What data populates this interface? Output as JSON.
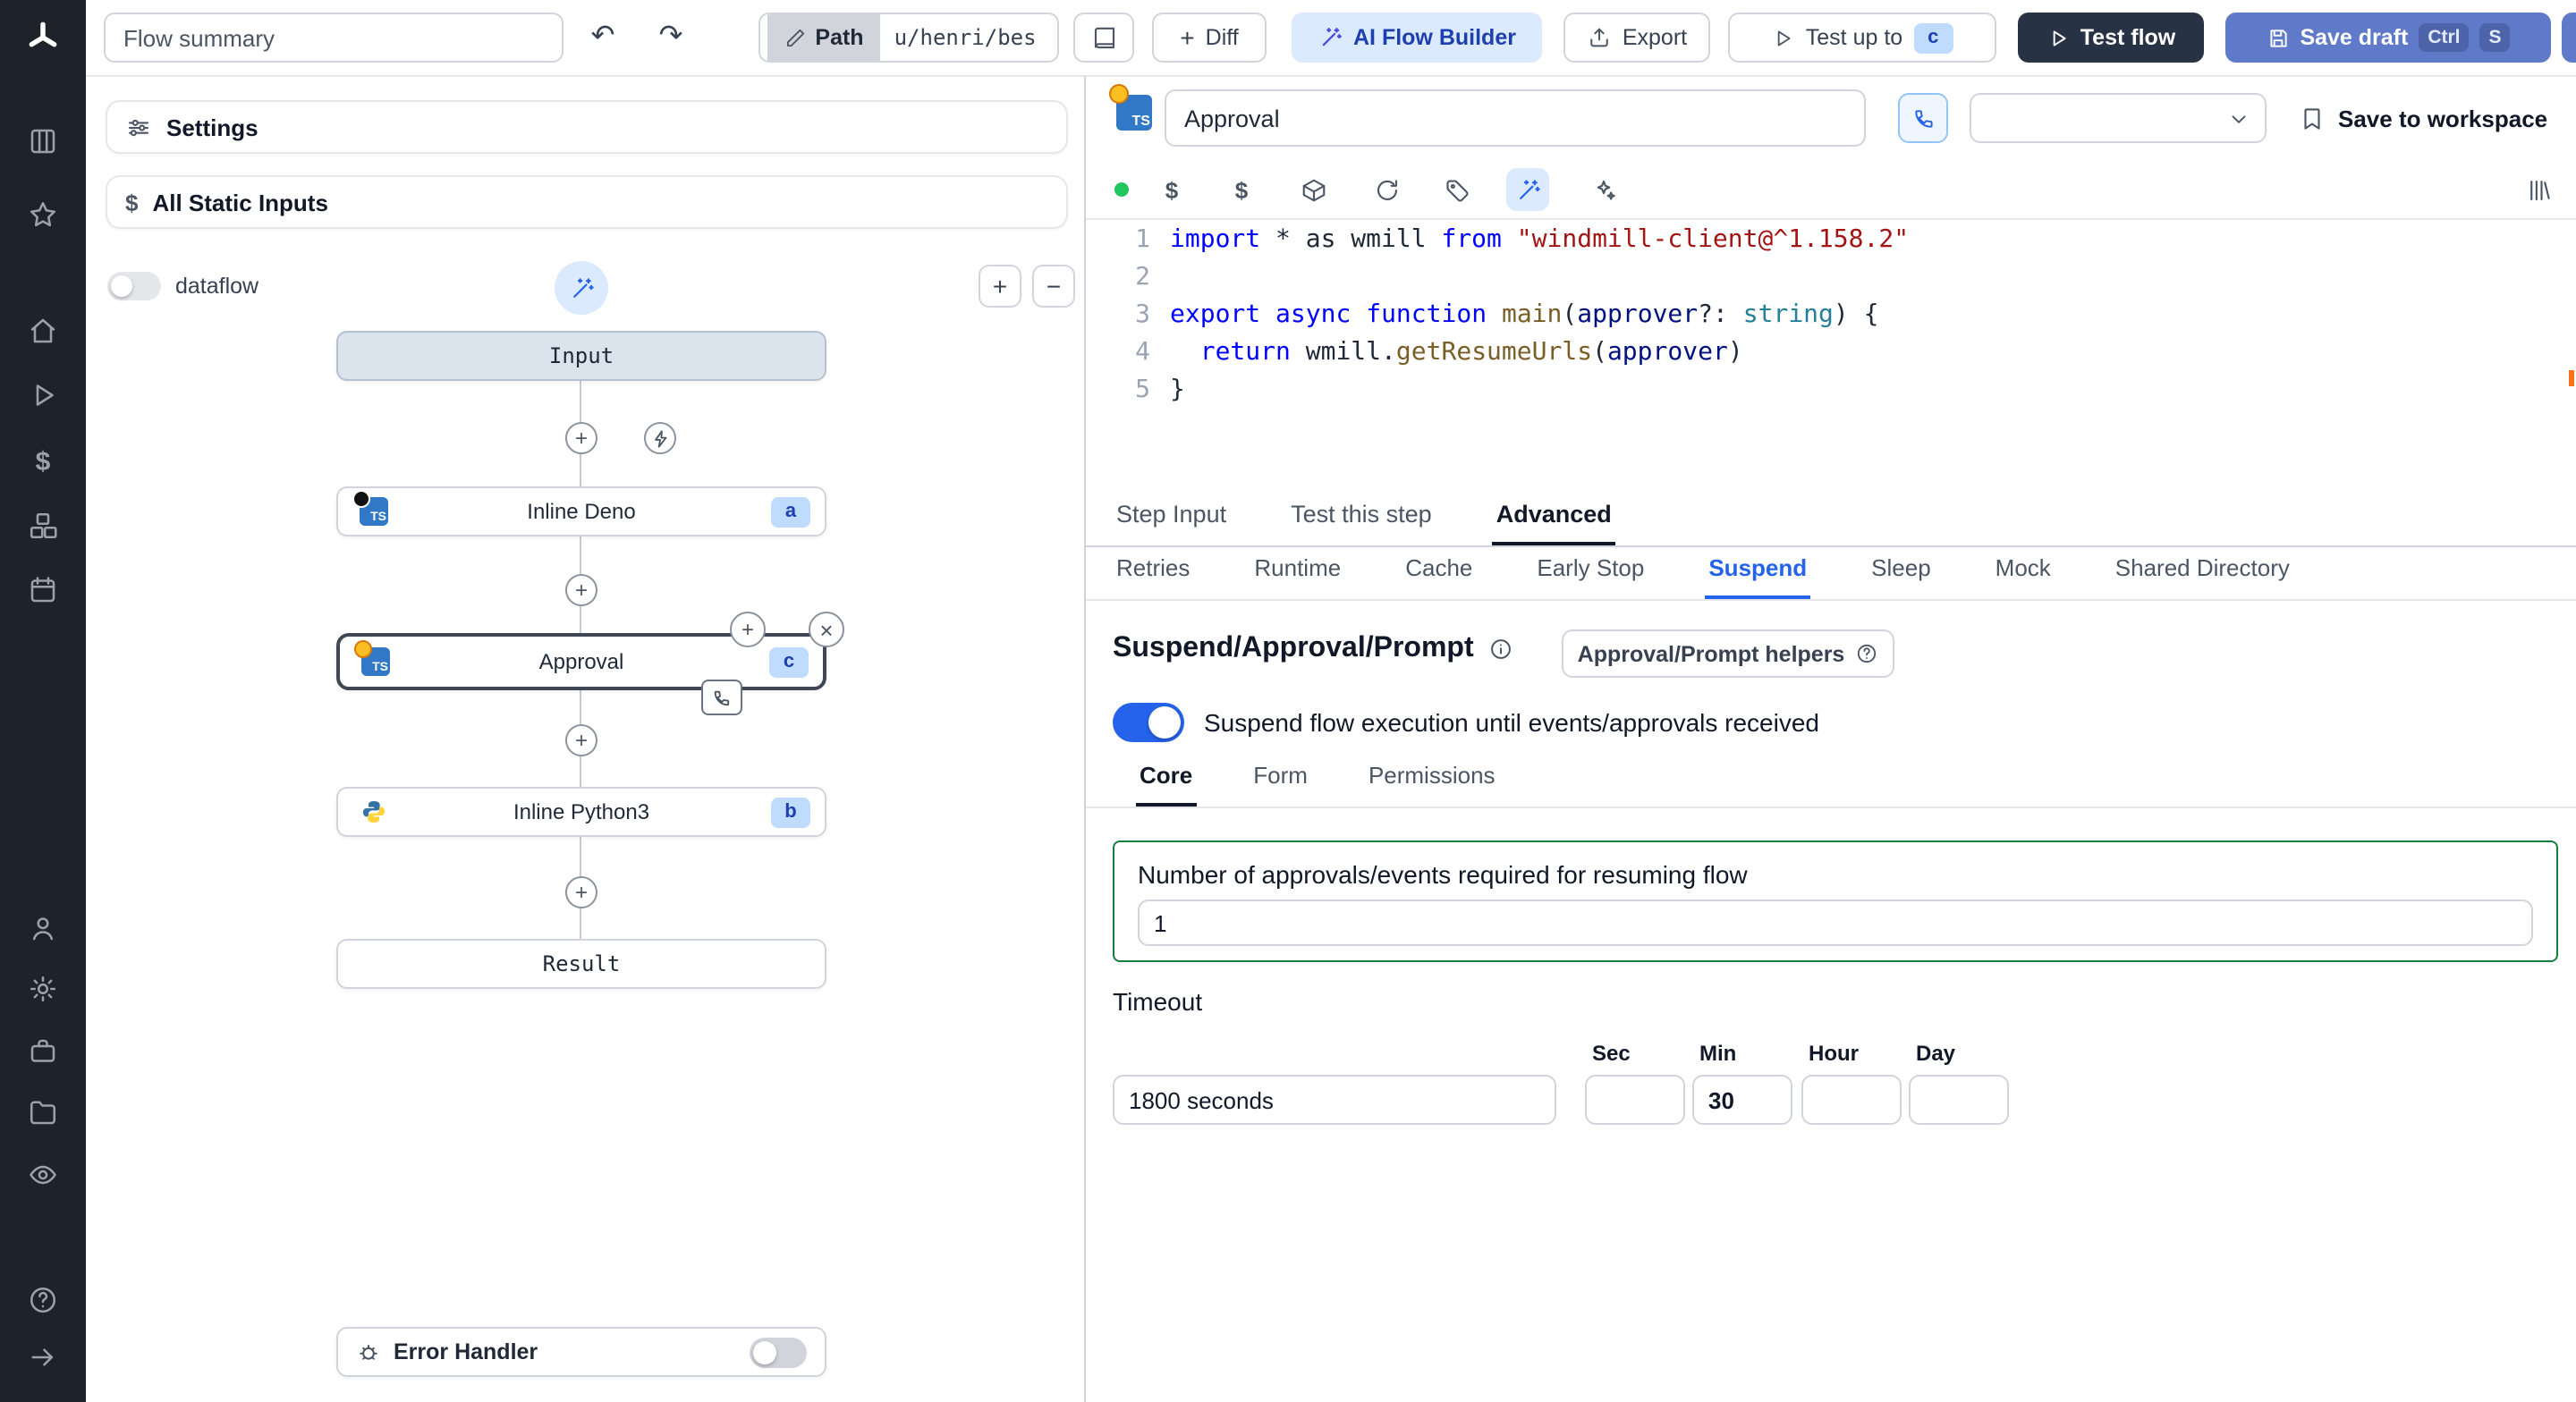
{
  "icons": {
    "undo": "↶",
    "redo": "↷",
    "plus": "+",
    "minus": "−",
    "close": "×",
    "dollar": "$",
    "ts": "TS"
  },
  "topbar": {
    "flow_summary_placeholder": "Flow summary",
    "path_label": "Path",
    "path_value": "u/henri/bes",
    "diff_label": "Diff",
    "ai_builder_label": "AI Flow Builder",
    "export_label": "Export",
    "test_up_to_label": "Test up to",
    "test_up_to_badge": "c",
    "test_flow_label": "Test flow",
    "save_draft_label": "Save draft",
    "save_draft_kbd1": "Ctrl",
    "save_draft_kbd2": "S"
  },
  "flow_panel": {
    "settings_label": "Settings",
    "static_inputs_label": "All Static Inputs",
    "dataflow_label": "dataflow",
    "input_node": "Input",
    "deno_node": "Inline Deno",
    "deno_badge": "a",
    "approval_node": "Approval",
    "approval_badge": "c",
    "python_node": "Inline Python3",
    "python_badge": "b",
    "result_node": "Result",
    "error_handler_label": "Error Handler"
  },
  "step_header": {
    "name_value": "Approval",
    "save_to_workspace_label": "Save to workspace"
  },
  "code": {
    "line_numbers": [
      "1",
      "2",
      "3",
      "4",
      "5"
    ],
    "lines": [
      [
        {
          "t": "import",
          "c": "kw"
        },
        {
          "t": " * as wmill ",
          "c": "pl"
        },
        {
          "t": "from",
          "c": "kw"
        },
        {
          "t": " ",
          "c": "pl"
        },
        {
          "t": "\"windmill-client@^1.158.2\"",
          "c": "str"
        }
      ],
      [],
      [
        {
          "t": "export",
          "c": "kw"
        },
        {
          "t": " ",
          "c": "pl"
        },
        {
          "t": "async",
          "c": "kw"
        },
        {
          "t": " ",
          "c": "pl"
        },
        {
          "t": "function",
          "c": "kw"
        },
        {
          "t": " ",
          "c": "pl"
        },
        {
          "t": "main",
          "c": "fn"
        },
        {
          "t": "(",
          "c": "pl"
        },
        {
          "t": "approver",
          "c": "var"
        },
        {
          "t": "?: ",
          "c": "pl"
        },
        {
          "t": "string",
          "c": "type"
        },
        {
          "t": ") {",
          "c": "pl"
        }
      ],
      [
        {
          "t": "  ",
          "c": "pl"
        },
        {
          "t": "return",
          "c": "kw"
        },
        {
          "t": " wmill.",
          "c": "pl"
        },
        {
          "t": "getResumeUrls",
          "c": "fn"
        },
        {
          "t": "(",
          "c": "pl"
        },
        {
          "t": "approver",
          "c": "var"
        },
        {
          "t": ")",
          "c": "pl"
        }
      ],
      [
        {
          "t": "}",
          "c": "pl"
        }
      ]
    ]
  },
  "step_tabs": {
    "step_input": "Step Input",
    "test_this_step": "Test this step",
    "advanced": "Advanced"
  },
  "advanced_tabs": {
    "retries": "Retries",
    "runtime": "Runtime",
    "cache": "Cache",
    "early_stop": "Early Stop",
    "suspend": "Suspend",
    "sleep": "Sleep",
    "mock": "Mock",
    "shared_directory": "Shared Directory"
  },
  "suspend": {
    "title": "Suspend/Approval/Prompt",
    "helpers_button": "Approval/Prompt helpers",
    "toggle_label": "Suspend flow execution until events/approvals received",
    "tab_core": "Core",
    "tab_form": "Form",
    "tab_permissions": "Permissions",
    "approvals_label": "Number of approvals/events required for resuming flow",
    "approvals_value": "1",
    "timeout_label": "Timeout",
    "timeout_value": "1800 seconds",
    "sec_label": "Sec",
    "sec_value": "",
    "min_label": "Min",
    "min_value": "30",
    "hour_label": "Hour",
    "hour_value": "",
    "day_label": "Day",
    "day_value": ""
  }
}
